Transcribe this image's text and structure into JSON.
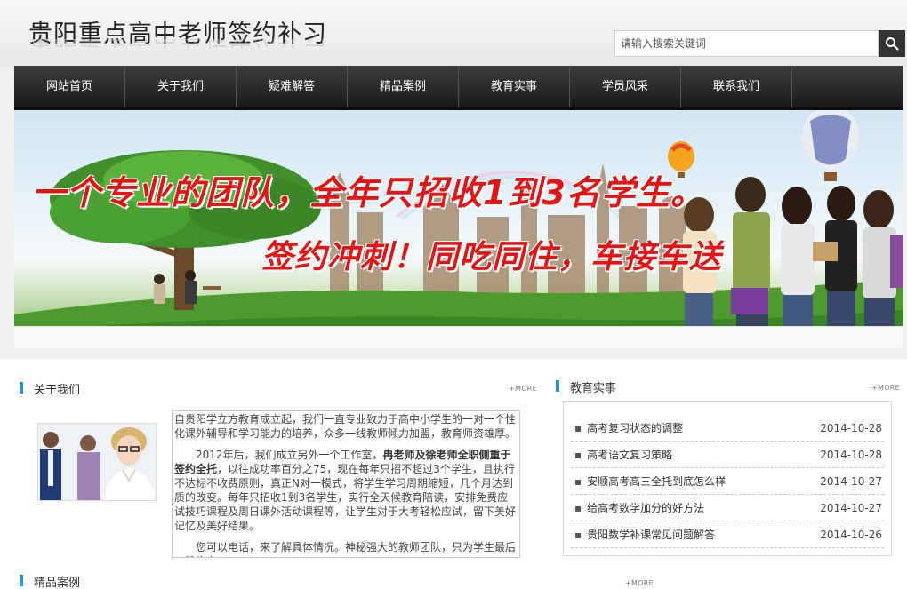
{
  "header": {
    "site_title": "贵阳重点高中老师签约补习",
    "search": {
      "placeholder": "请输入搜索关键词"
    }
  },
  "nav": {
    "items": [
      {
        "label": "网站首页"
      },
      {
        "label": "关于我们"
      },
      {
        "label": "疑难解答"
      },
      {
        "label": "精品案例"
      },
      {
        "label": "教育实事"
      },
      {
        "label": "学员风采"
      },
      {
        "label": "联系我们"
      }
    ]
  },
  "banner": {
    "slogan_line1": "一个专业的团队，全年只招收1到3名学生。",
    "slogan_line2": "签约冲刺！同吃同住，车接车送"
  },
  "about": {
    "title": "关于我们",
    "more": "+MORE",
    "para1": "自贵阳学立方教育成立起，我们一直专业致力于高中小学生的一对一个性化课外辅导和学习能力的培养，众多一线教师倾力加盟，教育师资雄厚。",
    "para2_a": "2012年后，我们成立另外一个工作室，",
    "para2_bold": "冉老师及徐老师全职侧重于签约全托",
    "para2_b": "，以往成功率百分之75，现在每年只招不超过3个学生，且执行不达标不收费原则，真正N对一模式，将学生学习周期缩短，几个月达到质的改变。每年只招收1到3名学生，实行全天候教育陪读，安排免费应试技巧课程及周日课外活动课程等，让学生对于大考轻松应试，留下美好记忆及美好结果。",
    "para3": "您可以电话，来了解具体情况。神秘强大的教师团队，只为学生最后一跳构力！"
  },
  "news": {
    "title": "教育实事",
    "more": "+MORE",
    "items": [
      {
        "title": "高考复习状态的调整",
        "date": "2014-10-28"
      },
      {
        "title": "高考语文复习策略",
        "date": "2014-10-28"
      },
      {
        "title": "安顺高考高三全托到底怎么样",
        "date": "2014-10-27"
      },
      {
        "title": "给高考数学加分的好方法",
        "date": "2014-10-27"
      },
      {
        "title": "贵阳数学补课常见问题解答",
        "date": "2014-10-26"
      }
    ]
  },
  "cases": {
    "title": "精品案例",
    "more": "+MORE"
  }
}
